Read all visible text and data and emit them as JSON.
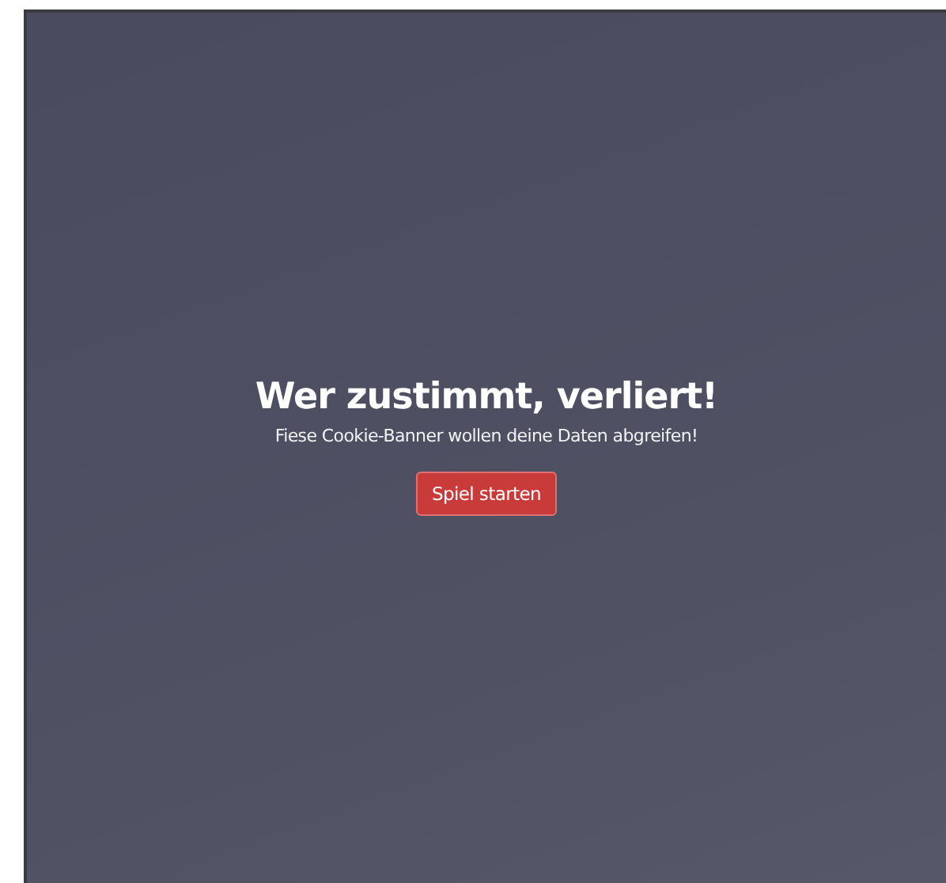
{
  "title": "Wer zustimmt, verliert!",
  "subtitle": "Fiese Cookie-Banner wollen deine Daten abgreifen!",
  "start_button": {
    "label": "Spiel starten"
  }
}
